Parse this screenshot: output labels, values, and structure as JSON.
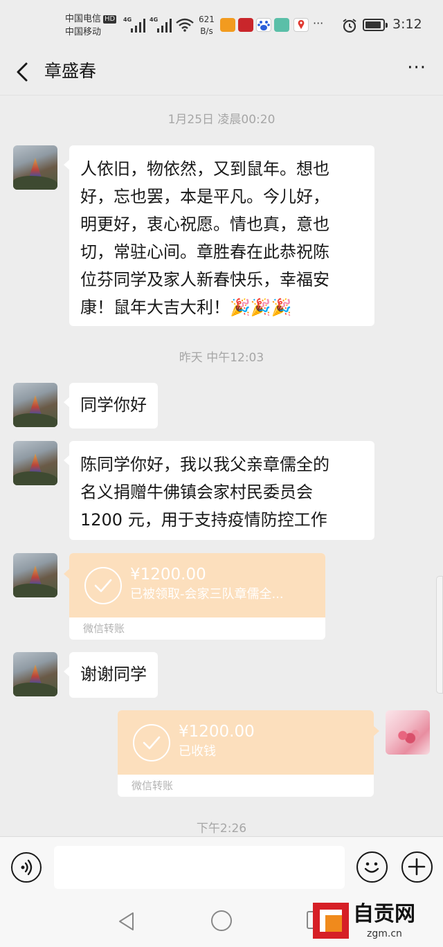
{
  "status_bar": {
    "carrier_1": "中国电信",
    "carrier_2": "中国移动",
    "hd_badge": "HD",
    "signal_tag_1": "4G",
    "signal_tag_2": "4G",
    "net_speed_value": "621",
    "net_speed_unit": "B/s",
    "app_icons": [
      "imou-icon",
      "chuanguan-icon",
      "baidu-icon",
      "photo-app-icon",
      "map-pin-icon"
    ],
    "overflow": "···",
    "time": "3:12"
  },
  "header": {
    "title": "章盛春",
    "back_icon": "chevron-left-icon",
    "menu_label": "···"
  },
  "messages": {
    "ts1": "1月25日 凌晨00:20",
    "msg1_lines": [
      "人依旧，物依然，又到鼠年。想也",
      "好，忘也罢，本是平凡。今儿好，",
      "明更好，衷心祝愿。情也真，意也",
      "切，常驻心间。章胜春在此恭祝陈",
      "位芬同学及家人新春快乐，幸福安",
      "康！鼠年大吉大利！🎉🎉🎉"
    ],
    "ts2": "昨天 中午12:03",
    "msg2": "同学你好",
    "msg3_lines": [
      "陈同学你好，我以我父亲章儒全的",
      "名义捐赠牛佛镇会家村民委员会",
      "1200 元，用于支持疫情防控工作"
    ],
    "transfer1": {
      "amount": "¥1200.00",
      "status": "已被领取-会家三队章儒全...",
      "footer": "微信转账"
    },
    "msg4": "谢谢同学",
    "transfer2": {
      "amount": "¥1200.00",
      "status": "已收钱",
      "footer": "微信转账"
    },
    "ts3": "下午2:26"
  },
  "input_bar": {
    "voice_icon": "voice-icon",
    "text_value": "",
    "emoji_icon": "emoji-icon",
    "plus_icon": "plus-icon"
  },
  "system_nav": {
    "back": "triangle-back-icon",
    "home": "circle-home-icon",
    "recent": "square-recent-icon"
  },
  "watermark": {
    "name": "自贡网",
    "url": "zgm.cn"
  },
  "colors": {
    "background": "#ededed",
    "bubble": "#ffffff",
    "transfer_received": "#fcdfbd",
    "timestamp": "#a6a6a6"
  }
}
